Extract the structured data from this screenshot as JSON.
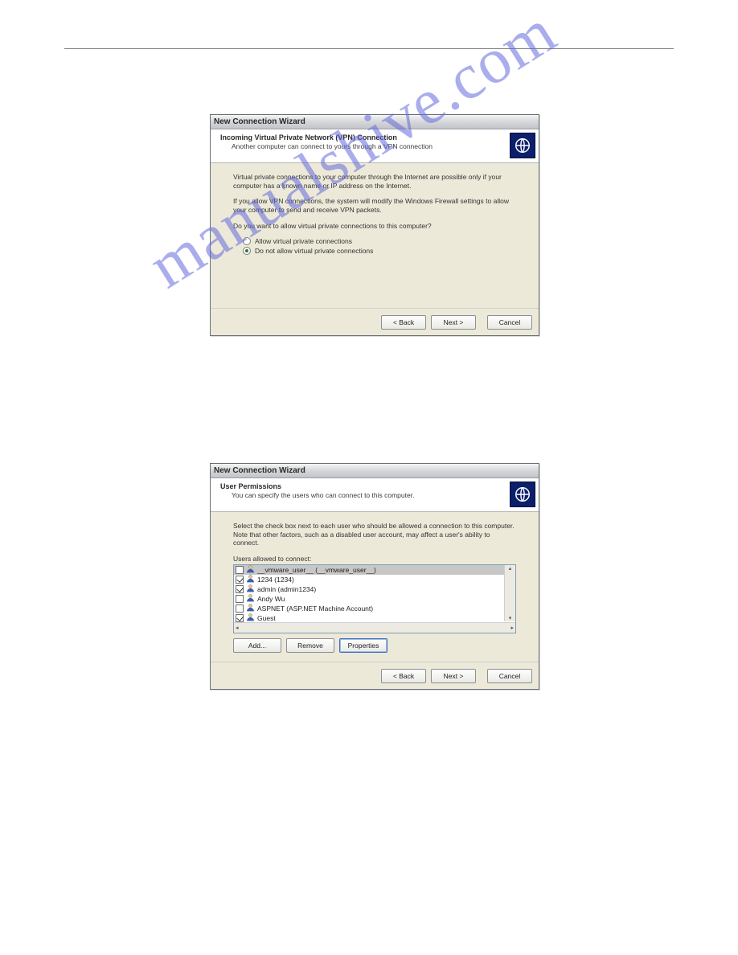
{
  "watermark": "manualshive.com",
  "dialog1": {
    "title": "New Connection Wizard",
    "header_title": "Incoming Virtual Private Network (VPN) Connection",
    "header_sub": "Another computer can connect to yours through a VPN connection",
    "para1": "Virtual private connections to your computer through the Internet are possible only if your computer has a known name or IP address on the Internet.",
    "para2": "If you allow VPN connections, the system will modify the Windows Firewall settings to allow your computer to send and receive VPN packets.",
    "question": "Do you want to allow virtual private connections to this computer?",
    "opt_allow": "Allow virtual private connections",
    "opt_disallow": "Do not allow virtual private connections",
    "back": "< Back",
    "next": "Next >",
    "cancel": "Cancel"
  },
  "dialog2": {
    "title": "New Connection Wizard",
    "header_title": "User Permissions",
    "header_sub": "You can specify the users who can connect to this computer.",
    "instructions": "Select the check box next to each user who should be allowed a connection to this computer. Note that other factors, such as a disabled user account, may affect a user's ability to connect.",
    "list_label": "Users allowed to connect:",
    "users": [
      {
        "checked": false,
        "selected": true,
        "label": "__vmware_user__ (__vmware_user__)"
      },
      {
        "checked": true,
        "selected": false,
        "label": "1234 (1234)"
      },
      {
        "checked": true,
        "selected": false,
        "label": "admin (admin1234)"
      },
      {
        "checked": false,
        "selected": false,
        "label": "Andy Wu"
      },
      {
        "checked": false,
        "selected": false,
        "label": "ASPNET (ASP.NET Machine Account)"
      },
      {
        "checked": true,
        "selected": false,
        "label": "Guest"
      }
    ],
    "btn_add": "Add...",
    "btn_remove": "Remove",
    "btn_props": "Properties",
    "back": "< Back",
    "next": "Next >",
    "cancel": "Cancel"
  }
}
